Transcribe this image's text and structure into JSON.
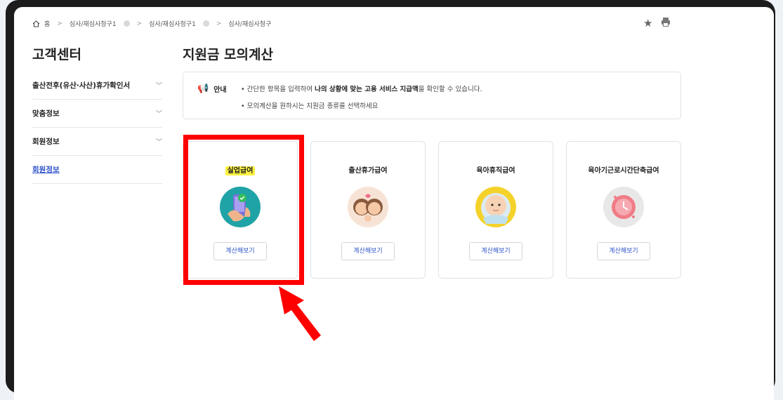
{
  "breadcrumb": {
    "home": "홈",
    "items": [
      "심사/재심사청구1",
      "심사/재심사청구1",
      "심사/재심사청구"
    ]
  },
  "icons": {
    "home": "home-icon",
    "star": "star-icon",
    "print": "print-icon",
    "notice": "megaphone-icon"
  },
  "sidebar": {
    "title": "고객센터",
    "items": [
      {
        "label": "출산전후(유산·사산)휴가확인서"
      },
      {
        "label": "맞춤정보"
      },
      {
        "label": "회원정보"
      },
      {
        "label": "회원정보"
      }
    ]
  },
  "main": {
    "title": "지원금 모의계산",
    "notice": {
      "label": "안내",
      "line1_pre": "• 간단한 항목을 입력하여 ",
      "line1_bold1": "나의 상황에 맞는 고용 서비스 지급액",
      "line1_post": "을 확인할 수 있습니다.",
      "line2": "• 모의계산을 원하시는 지원금 종류를 선택하세요"
    },
    "cards": [
      {
        "title": "실업급여",
        "button": "계산해보기"
      },
      {
        "title": "출산휴가급여",
        "button": "계산해보기"
      },
      {
        "title": "육아휴직급여",
        "button": "계산해보기"
      },
      {
        "title": "육아기근로시간단축급여",
        "button": "계산해보기"
      }
    ]
  },
  "colors": {
    "highlight": "#fbf140",
    "annotation": "#ff0000",
    "link": "#2b50c9"
  }
}
